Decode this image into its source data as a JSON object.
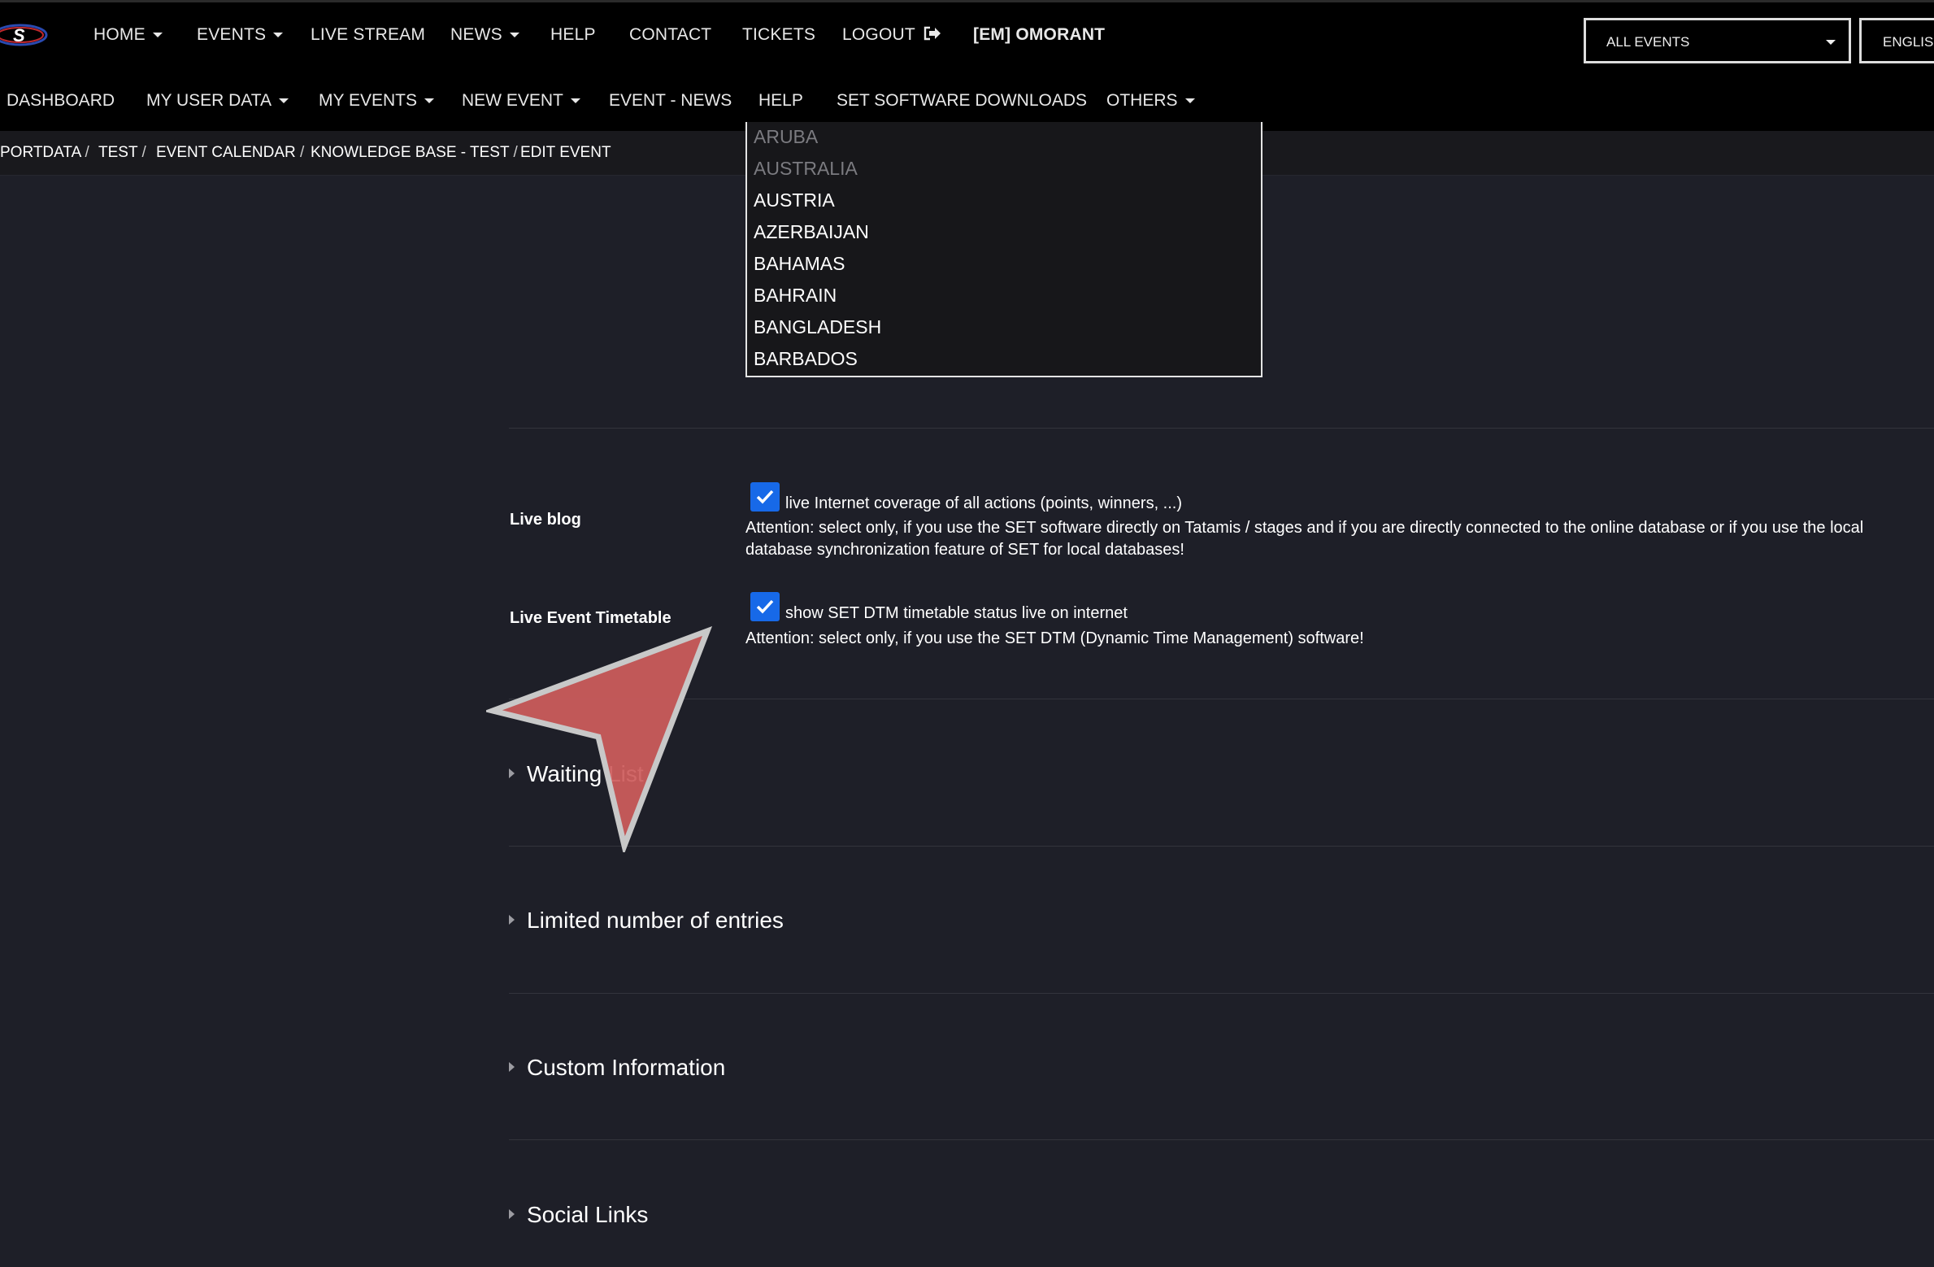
{
  "topnav": {
    "items": [
      "HOME",
      "EVENTS",
      "LIVE STREAM",
      "NEWS",
      "HELP",
      "CONTACT",
      "TICKETS",
      "LOGOUT"
    ],
    "user": "[EM] OMORANT",
    "event_select": "ALL EVENTS",
    "language_select": "ENGLISH"
  },
  "subnav": {
    "items": [
      "DASHBOARD",
      "MY USER DATA",
      "MY EVENTS",
      "NEW EVENT",
      "EVENT - NEWS",
      "HELP",
      "SET SOFTWARE DOWNLOADS",
      "OTHERS"
    ]
  },
  "breadcrumb": [
    "PORTDATA",
    "TEST",
    "EVENT CALENDAR",
    "KNOWLEDGE BASE - TEST",
    "EDIT EVENT"
  ],
  "country_list": [
    "ARUBA",
    "AUSTRALIA",
    "AUSTRIA",
    "AZERBAIJAN",
    "BAHAMAS",
    "BAHRAIN",
    "BANGLADESH",
    "BARBADOS"
  ],
  "live_blog": {
    "label": "Live blog",
    "checked": true,
    "checkbox_text": "live Internet coverage of all actions (points, winners, ...)",
    "note": "Attention: select only, if you use the SET software directly on Tatamis / stages and if you are directly connected to the online database or if you use the local database synchronization feature of SET for local databases!"
  },
  "live_timetable": {
    "label": "Live Event Timetable",
    "checked": true,
    "checkbox_text": "show SET DTM timetable status live on internet",
    "note": "Attention: select only, if you use the SET DTM (Dynamic Time Management) software!"
  },
  "sections": [
    "Waiting List",
    "Limited number of entries",
    "Custom Information",
    "Social Links"
  ],
  "colors": {
    "background": "#1e1f28",
    "nav": "#000000",
    "checkbox": "#1769e8",
    "cursor": "#cd5c5c"
  }
}
